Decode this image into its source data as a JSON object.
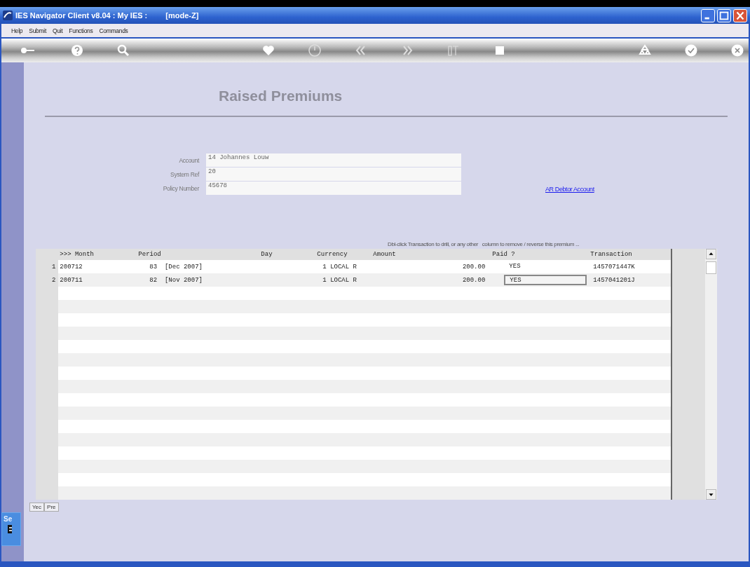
{
  "window": {
    "title": "IES Navigator Client v8.04 : My IES :",
    "mode": "[mode-Z]"
  },
  "menu": [
    "Help",
    "Submit",
    "Quit",
    "Functions",
    "Commands"
  ],
  "page_title": "Raised Premiums",
  "fields": [
    {
      "label": "Account",
      "value": "14 Johannes Louw"
    },
    {
      "label": "System Ref",
      "value": "20"
    },
    {
      "label": "Policy Number",
      "value": "45678"
    }
  ],
  "link": "AR Debtor Account",
  "hint": "Dbl-click Transaction to drill, or any other   column to remove / reverse this premium ...",
  "table": {
    "columns": [
      ">>> Month",
      "Period",
      "Day",
      "Currency",
      "Amount",
      "Paid ?",
      "Transaction"
    ],
    "rows": [
      {
        "number": "1",
        "cells": [
          "200712",
          "83  [Dec 2007]",
          "",
          "1 LOCAL R",
          "200.00",
          "YES",
          "1457071447K"
        ],
        "focused": false
      },
      {
        "number": "2",
        "cells": [
          "200711",
          "82  [Nov 2007]",
          "",
          "1 LOCAL R",
          "200.00",
          "YES",
          "1457041201J"
        ],
        "focused": true
      }
    ]
  },
  "bottom_tabs": [
    "Yec",
    "Pre"
  ],
  "side_tab": "Se"
}
